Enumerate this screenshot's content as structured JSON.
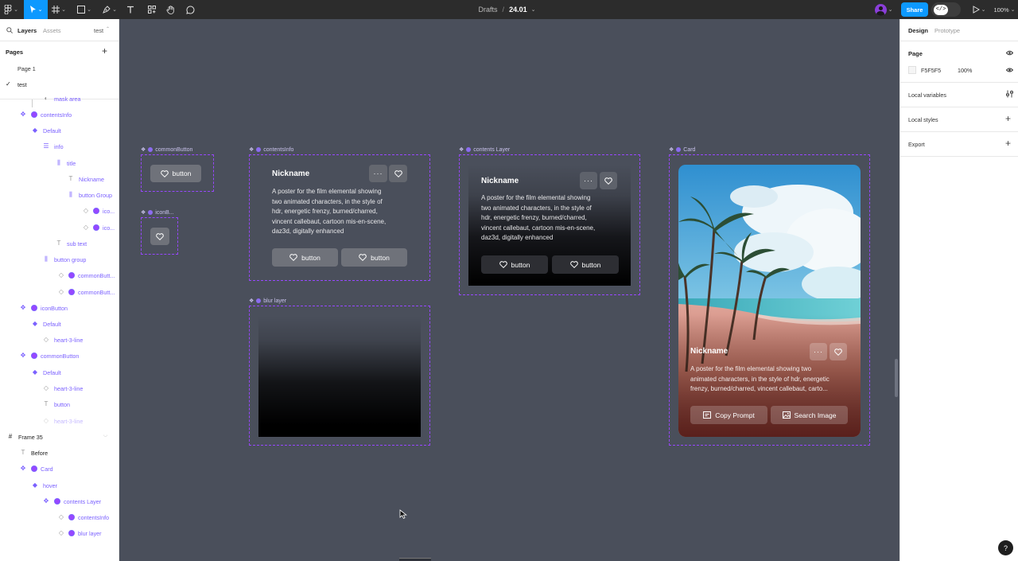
{
  "toolbar": {
    "breadcrumb_drafts": "Drafts",
    "breadcrumb_sep": "/",
    "file_name": "24.01",
    "share_label": "Share",
    "zoom_label": "100%"
  },
  "left_panel": {
    "tabs": {
      "layers": "Layers",
      "assets": "Assets",
      "page_switch": "test"
    },
    "pages_title": "Pages",
    "pages": [
      "Page 1",
      "test"
    ],
    "layers": [
      {
        "label": "mask area",
        "icon": "mask"
      },
      {
        "label": "contentsInfo",
        "icon": "instance"
      },
      {
        "label": "Default",
        "icon": "variant"
      },
      {
        "label": "info",
        "icon": "autolayout-vertical"
      },
      {
        "label": "title",
        "icon": "autolayout-horizontal"
      },
      {
        "label": "Nickname",
        "icon": "text"
      },
      {
        "label": "button Group",
        "icon": "autolayout-horizontal"
      },
      {
        "label": "ico...",
        "icon": "instance"
      },
      {
        "label": "ico...",
        "icon": "instance"
      },
      {
        "label": "sub text",
        "icon": "text"
      },
      {
        "label": "button group",
        "icon": "autolayout-horizontal"
      },
      {
        "label": "commonButt...",
        "icon": "instance"
      },
      {
        "label": "commonButt...",
        "icon": "instance"
      },
      {
        "label": "iconButton",
        "icon": "instance"
      },
      {
        "label": "Default",
        "icon": "variant"
      },
      {
        "label": "heart-3-line",
        "icon": "vector"
      },
      {
        "label": "commonButton",
        "icon": "instance"
      },
      {
        "label": "Default",
        "icon": "variant"
      },
      {
        "label": "heart-3-line",
        "icon": "vector"
      },
      {
        "label": "button",
        "icon": "text"
      },
      {
        "label": "heart-3-line",
        "icon": "vector"
      },
      {
        "label": "Frame 35",
        "icon": "frame"
      },
      {
        "label": "Before",
        "icon": "text"
      },
      {
        "label": "Card",
        "icon": "instance"
      },
      {
        "label": "hover",
        "icon": "variant"
      },
      {
        "label": "contents Layer",
        "icon": "instance"
      },
      {
        "label": "contentsInfo",
        "icon": "instance"
      },
      {
        "label": "blur layer",
        "icon": "instance"
      }
    ]
  },
  "right_panel": {
    "tabs": {
      "design": "Design",
      "prototype": "Prototype"
    },
    "page_section": "Page",
    "page_color": "F5F5F5",
    "page_opacity": "100%",
    "local_variables": "Local variables",
    "local_styles": "Local styles",
    "export": "Export",
    "help": "?"
  },
  "canvas": {
    "frame_labels": {
      "common_button": "commonButton",
      "icon_button": "iconB...",
      "contents_info": "contentsInfo",
      "blur_layer": "blur layer",
      "contents_layer": "contents Layer",
      "card": "Card"
    },
    "button_label": "button",
    "nickname": "Nickname",
    "description_lines": [
      "A poster for the film elemental showing",
      "two animated characters, in the style of",
      "hdr, energetic frenzy, burned/charred,",
      "vincent callebaut, cartoon mis-en-scene,",
      "daz3d, digitally enhanced"
    ],
    "card": {
      "nickname": "Nickname",
      "description_lines": [
        "A poster for the film elemental showing two",
        "animated characters, in the style of hdr, energetic",
        "frenzy, burned/charred, vincent callebaut, carto..."
      ],
      "copy_prompt": "Copy Prompt",
      "search_image": "Search Image"
    }
  }
}
